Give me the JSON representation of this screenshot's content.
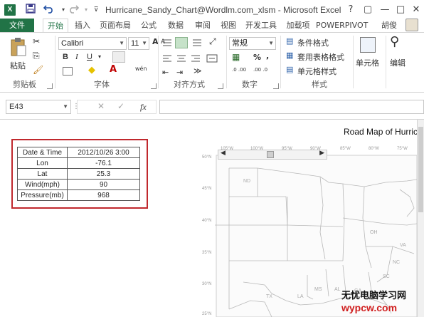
{
  "window": {
    "title": "Hurricane_Sandy_Chart@Wordlm.com_xlsm - Microsoft Excel",
    "app_icon": "X",
    "controls": [
      "?",
      "▢",
      "—",
      "□",
      "✕"
    ]
  },
  "ribbon_tabs": [
    {
      "label": "文件"
    },
    {
      "label": "开始"
    },
    {
      "label": "插入"
    },
    {
      "label": "页面布局"
    },
    {
      "label": "公式"
    },
    {
      "label": "数据"
    },
    {
      "label": "审阅"
    },
    {
      "label": "视图"
    },
    {
      "label": "开发工具"
    },
    {
      "label": "加载项"
    },
    {
      "label": "POWERPIVOT"
    },
    {
      "label": "胡俊"
    }
  ],
  "ribbon": {
    "clipboard": {
      "paste": "粘贴",
      "label": "剪贴板"
    },
    "font": {
      "name": "Calibri",
      "size": "11",
      "bold": "B",
      "italic": "I",
      "underline": "U",
      "grow": "A",
      "shrink": "A",
      "wen": "wén",
      "label": "字体"
    },
    "alignment": {
      "label": "对齐方式"
    },
    "number": {
      "format": "常规",
      "percent": "%",
      "comma": ",",
      "dec_inc": ".0 .00",
      "dec_dec": ".00 .0",
      "label": "数字"
    },
    "styles": {
      "conditional": "条件格式",
      "table": "套用表格格式",
      "cell": "单元格样式",
      "label": "样式"
    },
    "cells": {
      "label": "单元格"
    },
    "editing": {
      "label": "编辑"
    }
  },
  "formula_bar": {
    "name_box": "E43",
    "fx": "fx",
    "cancel": "✕",
    "enter": "✓",
    "formula": ""
  },
  "data_table": [
    {
      "label": "Date & Time",
      "value": "2012/10/26 3:00"
    },
    {
      "label": "Lon",
      "value": "-76.1"
    },
    {
      "label": "Lat",
      "value": "25.3"
    },
    {
      "label": "Wind(mph)",
      "value": "90"
    },
    {
      "label": "Pressure(mb)",
      "value": "968"
    }
  ],
  "map": {
    "title": "Road Map of Hurric",
    "lon_labels": [
      "105°W",
      "100°W",
      "95°W",
      "90°W",
      "85°W",
      "80°W",
      "75°W"
    ],
    "lat_labels": [
      "50°N",
      "45°N",
      "40°N",
      "35°N",
      "30°N",
      "25°N"
    ],
    "state_labels": [
      "ND",
      "OH",
      "VA",
      "NC",
      "SC",
      "TX",
      "LA",
      "MS",
      "AL",
      "GA"
    ],
    "scroll_left": "◀",
    "scroll_right": "▶"
  },
  "watermark": {
    "line1": "无忧电脑学习网",
    "line2": "wypcw.com"
  },
  "colors": {
    "excel_green": "#217346",
    "highlight_border": "#c0282d"
  }
}
